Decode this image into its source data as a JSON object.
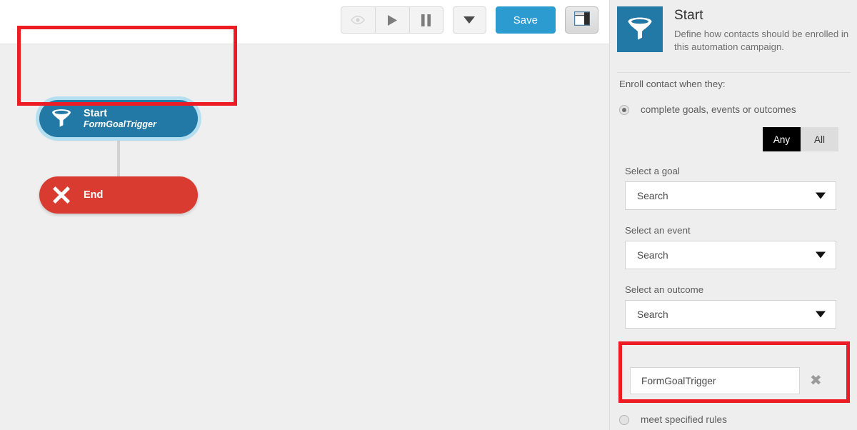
{
  "toolbar": {
    "buttons": [
      {
        "name": "preview-button",
        "icon": "eye-icon",
        "state": "disabled"
      },
      {
        "name": "play-button",
        "icon": "play-icon",
        "state": "enabled"
      },
      {
        "name": "pause-button",
        "icon": "pause-icon",
        "state": "enabled"
      },
      {
        "name": "more-actions-button",
        "icon": "chevron-down-icon",
        "state": "enabled"
      }
    ],
    "save_label": "Save",
    "panel_toggle_icon": "panel-layout-icon"
  },
  "canvas": {
    "nodes": [
      {
        "id": "start",
        "title": "Start",
        "subtitle": "FormGoalTrigger",
        "icon": "funnel-icon",
        "color": "#2379a5",
        "selected": true
      },
      {
        "id": "end",
        "title": "End",
        "subtitle": "",
        "icon": "x-mark-icon",
        "color": "#d93b31",
        "selected": false
      }
    ],
    "annotation_color": "#ed1c24"
  },
  "panel": {
    "icon": "funnel-icon",
    "title": "Start",
    "description": "Define how contacts should be enrolled in this automation campaign.",
    "section_label": "Enroll contact when they:",
    "options": [
      {
        "id": "complete-goals",
        "label": "complete goals, events or outcomes",
        "checked": true
      },
      {
        "id": "meet-rules",
        "label": "meet specified rules",
        "checked": false
      }
    ],
    "match_toggle": {
      "any_label": "Any",
      "all_label": "All",
      "selected": "Any"
    },
    "fields": [
      {
        "id": "goal",
        "label": "Select a goal",
        "value": "Search"
      },
      {
        "id": "event",
        "label": "Select an event",
        "value": "Search"
      },
      {
        "id": "outcome",
        "label": "Select an outcome",
        "value": "Search"
      }
    ],
    "selected_chip": {
      "value": "FormGoalTrigger",
      "remove_label": "✖"
    }
  },
  "colors": {
    "accent_blue": "#2b9bd0",
    "node_blue": "#2379a5",
    "node_red": "#d93b31",
    "annotation_red": "#ed1c24",
    "canvas_bg": "#efefef",
    "panel_bg": "#eeeeee"
  }
}
